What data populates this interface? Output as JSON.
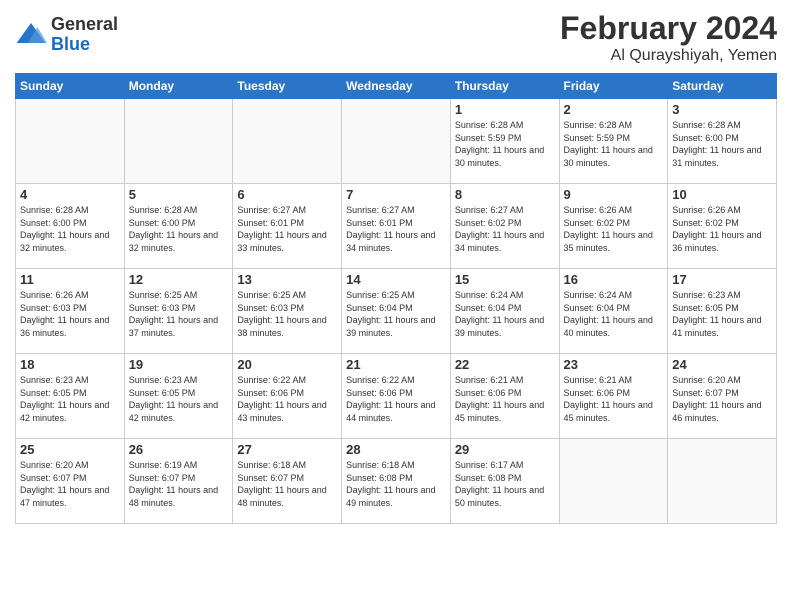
{
  "logo": {
    "general": "General",
    "blue": "Blue"
  },
  "title": {
    "month_year": "February 2024",
    "location": "Al Qurayshiyah, Yemen"
  },
  "days_of_week": [
    "Sunday",
    "Monday",
    "Tuesday",
    "Wednesday",
    "Thursday",
    "Friday",
    "Saturday"
  ],
  "weeks": [
    [
      {
        "day": "",
        "info": ""
      },
      {
        "day": "",
        "info": ""
      },
      {
        "day": "",
        "info": ""
      },
      {
        "day": "",
        "info": ""
      },
      {
        "day": "1",
        "info": "Sunrise: 6:28 AM\nSunset: 5:59 PM\nDaylight: 11 hours and 30 minutes."
      },
      {
        "day": "2",
        "info": "Sunrise: 6:28 AM\nSunset: 5:59 PM\nDaylight: 11 hours and 30 minutes."
      },
      {
        "day": "3",
        "info": "Sunrise: 6:28 AM\nSunset: 6:00 PM\nDaylight: 11 hours and 31 minutes."
      }
    ],
    [
      {
        "day": "4",
        "info": "Sunrise: 6:28 AM\nSunset: 6:00 PM\nDaylight: 11 hours and 32 minutes."
      },
      {
        "day": "5",
        "info": "Sunrise: 6:28 AM\nSunset: 6:00 PM\nDaylight: 11 hours and 32 minutes."
      },
      {
        "day": "6",
        "info": "Sunrise: 6:27 AM\nSunset: 6:01 PM\nDaylight: 11 hours and 33 minutes."
      },
      {
        "day": "7",
        "info": "Sunrise: 6:27 AM\nSunset: 6:01 PM\nDaylight: 11 hours and 34 minutes."
      },
      {
        "day": "8",
        "info": "Sunrise: 6:27 AM\nSunset: 6:02 PM\nDaylight: 11 hours and 34 minutes."
      },
      {
        "day": "9",
        "info": "Sunrise: 6:26 AM\nSunset: 6:02 PM\nDaylight: 11 hours and 35 minutes."
      },
      {
        "day": "10",
        "info": "Sunrise: 6:26 AM\nSunset: 6:02 PM\nDaylight: 11 hours and 36 minutes."
      }
    ],
    [
      {
        "day": "11",
        "info": "Sunrise: 6:26 AM\nSunset: 6:03 PM\nDaylight: 11 hours and 36 minutes."
      },
      {
        "day": "12",
        "info": "Sunrise: 6:25 AM\nSunset: 6:03 PM\nDaylight: 11 hours and 37 minutes."
      },
      {
        "day": "13",
        "info": "Sunrise: 6:25 AM\nSunset: 6:03 PM\nDaylight: 11 hours and 38 minutes."
      },
      {
        "day": "14",
        "info": "Sunrise: 6:25 AM\nSunset: 6:04 PM\nDaylight: 11 hours and 39 minutes."
      },
      {
        "day": "15",
        "info": "Sunrise: 6:24 AM\nSunset: 6:04 PM\nDaylight: 11 hours and 39 minutes."
      },
      {
        "day": "16",
        "info": "Sunrise: 6:24 AM\nSunset: 6:04 PM\nDaylight: 11 hours and 40 minutes."
      },
      {
        "day": "17",
        "info": "Sunrise: 6:23 AM\nSunset: 6:05 PM\nDaylight: 11 hours and 41 minutes."
      }
    ],
    [
      {
        "day": "18",
        "info": "Sunrise: 6:23 AM\nSunset: 6:05 PM\nDaylight: 11 hours and 42 minutes."
      },
      {
        "day": "19",
        "info": "Sunrise: 6:23 AM\nSunset: 6:05 PM\nDaylight: 11 hours and 42 minutes."
      },
      {
        "day": "20",
        "info": "Sunrise: 6:22 AM\nSunset: 6:06 PM\nDaylight: 11 hours and 43 minutes."
      },
      {
        "day": "21",
        "info": "Sunrise: 6:22 AM\nSunset: 6:06 PM\nDaylight: 11 hours and 44 minutes."
      },
      {
        "day": "22",
        "info": "Sunrise: 6:21 AM\nSunset: 6:06 PM\nDaylight: 11 hours and 45 minutes."
      },
      {
        "day": "23",
        "info": "Sunrise: 6:21 AM\nSunset: 6:06 PM\nDaylight: 11 hours and 45 minutes."
      },
      {
        "day": "24",
        "info": "Sunrise: 6:20 AM\nSunset: 6:07 PM\nDaylight: 11 hours and 46 minutes."
      }
    ],
    [
      {
        "day": "25",
        "info": "Sunrise: 6:20 AM\nSunset: 6:07 PM\nDaylight: 11 hours and 47 minutes."
      },
      {
        "day": "26",
        "info": "Sunrise: 6:19 AM\nSunset: 6:07 PM\nDaylight: 11 hours and 48 minutes."
      },
      {
        "day": "27",
        "info": "Sunrise: 6:18 AM\nSunset: 6:07 PM\nDaylight: 11 hours and 48 minutes."
      },
      {
        "day": "28",
        "info": "Sunrise: 6:18 AM\nSunset: 6:08 PM\nDaylight: 11 hours and 49 minutes."
      },
      {
        "day": "29",
        "info": "Sunrise: 6:17 AM\nSunset: 6:08 PM\nDaylight: 11 hours and 50 minutes."
      },
      {
        "day": "",
        "info": ""
      },
      {
        "day": "",
        "info": ""
      }
    ]
  ]
}
